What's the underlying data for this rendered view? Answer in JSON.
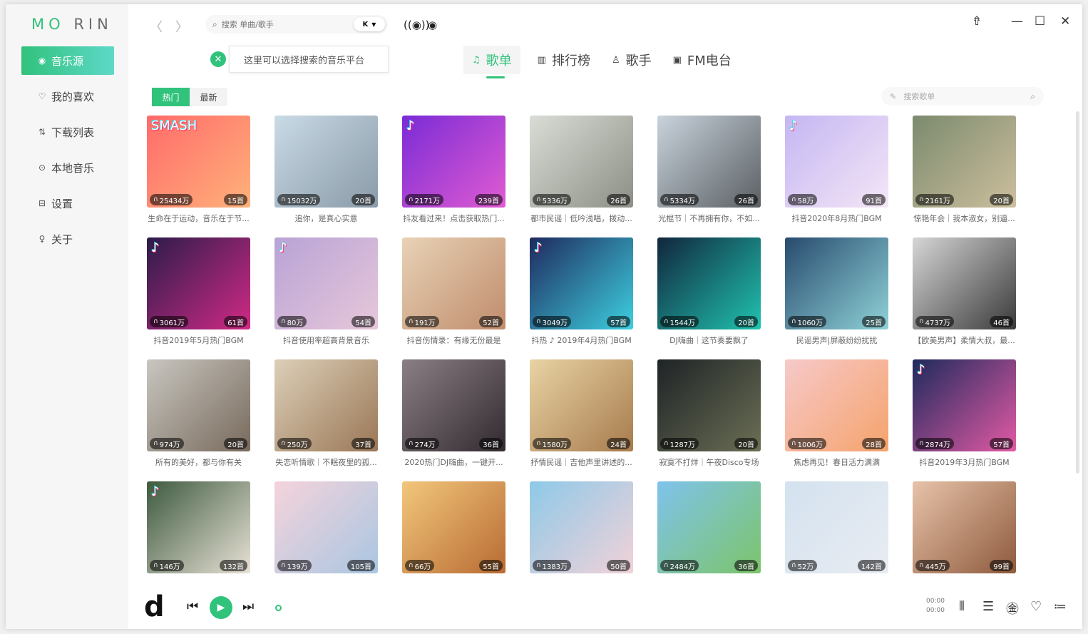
{
  "app": {
    "logo_a": "MO",
    "logo_b": "RIN"
  },
  "sidebar": {
    "items": [
      {
        "label": "音乐源",
        "icon": "music-source-icon",
        "glyph": "◉",
        "active": true
      },
      {
        "label": "我的喜欢",
        "icon": "heart-icon",
        "glyph": "♡",
        "active": false
      },
      {
        "label": "下载列表",
        "icon": "download-list-icon",
        "glyph": "⇅",
        "active": false
      },
      {
        "label": "本地音乐",
        "icon": "local-music-icon",
        "glyph": "⊙",
        "active": false
      },
      {
        "label": "设置",
        "icon": "settings-icon",
        "glyph": "⊟",
        "active": false
      },
      {
        "label": "关于",
        "icon": "bulb-icon",
        "glyph": "♀",
        "active": false
      }
    ]
  },
  "search": {
    "placeholder": "搜索 单曲/歌手",
    "platform": "K"
  },
  "tooltip": {
    "text": "这里可以选择搜索的音乐平台"
  },
  "tabs": [
    {
      "label": "歌单",
      "icon": "playlist-icon",
      "glyph": "♫",
      "active": true
    },
    {
      "label": "排行榜",
      "icon": "chart-icon",
      "glyph": "▥",
      "active": false
    },
    {
      "label": "歌手",
      "icon": "singer-icon",
      "glyph": "♙",
      "active": false
    },
    {
      "label": "FM电台",
      "icon": "radio-icon",
      "glyph": "▣",
      "active": false
    }
  ],
  "subtabs": [
    {
      "label": "热门",
      "active": true
    },
    {
      "label": "最新",
      "active": false
    }
  ],
  "playlist_search": {
    "placeholder": "搜索歌单"
  },
  "playlists": [
    {
      "title": "生命在于运动，音乐在于节...",
      "plays": "25434万",
      "count": "15首",
      "c1": "#ff6a6a",
      "c2": "#ffb27a",
      "tag": "SMASH"
    },
    {
      "title": "追你，是真心实意",
      "plays": "15032万",
      "count": "20首",
      "c1": "#c9dbe6",
      "c2": "#8a9aa8",
      "tag": ""
    },
    {
      "title": "抖友看过来！点击获取热门...",
      "plays": "2171万",
      "count": "239首",
      "c1": "#7a2bd6",
      "c2": "#e05bd2",
      "tag": "♪"
    },
    {
      "title": "都市民谣｜低吟浅唱，拨动...",
      "plays": "5336万",
      "count": "26首",
      "c1": "#d9ddd5",
      "c2": "#8c8f86",
      "tag": ""
    },
    {
      "title": "光棍节｜不再拥有你，不如...",
      "plays": "5334万",
      "count": "26首",
      "c1": "#c9d3dc",
      "c2": "#5a5f63",
      "tag": ""
    },
    {
      "title": "抖音2020年8月热门BGM",
      "plays": "58万",
      "count": "91首",
      "c1": "#c4b6f2",
      "c2": "#f4e6f6",
      "tag": "♪"
    },
    {
      "title": "惊艳年会｜我本淑女，别逼...",
      "plays": "2161万",
      "count": "20首",
      "c1": "#7b8a6e",
      "c2": "#cdbf9d",
      "tag": ""
    },
    {
      "title": "抖音2019年5月热门BGM",
      "plays": "3061万",
      "count": "61首",
      "c1": "#2c1c4a",
      "c2": "#d12a86",
      "tag": "♪"
    },
    {
      "title": "抖音使用率超高背景音乐",
      "plays": "80万",
      "count": "54首",
      "c1": "#b8a3d6",
      "c2": "#e7c7d9",
      "tag": "♪"
    },
    {
      "title": "抖音伤情录：有缘无份最是",
      "plays": "191万",
      "count": "52首",
      "c1": "#e8d2b6",
      "c2": "#c08c6c",
      "tag": ""
    },
    {
      "title": "抖热 ♪ 2019年4月热门BGM",
      "plays": "3049万",
      "count": "57首",
      "c1": "#1f2a5e",
      "c2": "#3dd0e0",
      "tag": "♪"
    },
    {
      "title": "DJ嗨曲｜这节奏要飘了",
      "plays": "1544万",
      "count": "20首",
      "c1": "#11263d",
      "c2": "#20c3b0",
      "tag": ""
    },
    {
      "title": "民谣男声|屏蔽纷纷扰扰",
      "plays": "1060万",
      "count": "25首",
      "c1": "#284b6e",
      "c2": "#8fd2d8",
      "tag": ""
    },
    {
      "title": "【欧美男声】柔情大叔，最...",
      "plays": "4737万",
      "count": "46首",
      "c1": "#d6d6d6",
      "c2": "#3a3a3a",
      "tag": ""
    },
    {
      "title": "所有的美好，都与你有关",
      "plays": "974万",
      "count": "20首",
      "c1": "#c8c6c0",
      "c2": "#786a5c",
      "tag": ""
    },
    {
      "title": "失恋听情歌｜不眠夜里的孤...",
      "plays": "250万",
      "count": "37首",
      "c1": "#dccfb8",
      "c2": "#9a7756",
      "tag": ""
    },
    {
      "title": "2020热门DJ嗨曲，一键开...",
      "plays": "274万",
      "count": "36首",
      "c1": "#8a7f85",
      "c2": "#322a30",
      "tag": ""
    },
    {
      "title": "抒情民谣｜吉他声里讲述的...",
      "plays": "1580万",
      "count": "24首",
      "c1": "#e8d3a4",
      "c2": "#a77b4d",
      "tag": ""
    },
    {
      "title": "寂寞不打烊｜午夜Disco专场",
      "plays": "1287万",
      "count": "20首",
      "c1": "#1e2326",
      "c2": "#6b6f55",
      "tag": ""
    },
    {
      "title": "焦虑再见！春日活力满满",
      "plays": "1006万",
      "count": "28首",
      "c1": "#f6c9c9",
      "c2": "#f5a36c",
      "tag": ""
    },
    {
      "title": "抖音2019年3月热门BGM",
      "plays": "2874万",
      "count": "57首",
      "c1": "#1e2a5c",
      "c2": "#e35aa5",
      "tag": "♪"
    },
    {
      "title": "",
      "plays": "146万",
      "count": "132首",
      "c1": "#3d5a3f",
      "c2": "#e9e2d6",
      "tag": "♪"
    },
    {
      "title": "",
      "plays": "139万",
      "count": "105首",
      "c1": "#f5d3db",
      "c2": "#a9c6e2",
      "tag": ""
    },
    {
      "title": "",
      "plays": "66万",
      "count": "55首",
      "c1": "#f2c77c",
      "c2": "#b86b32",
      "tag": ""
    },
    {
      "title": "",
      "plays": "1383万",
      "count": "50首",
      "c1": "#8ec9e8",
      "c2": "#f2d2d8",
      "tag": ""
    },
    {
      "title": "",
      "plays": "2484万",
      "count": "36首",
      "c1": "#7fc3ec",
      "c2": "#7cc46a",
      "tag": ""
    },
    {
      "title": "",
      "plays": "52万",
      "count": "142首",
      "c1": "#d3e2ef",
      "c2": "#e9ecf2",
      "tag": ""
    },
    {
      "title": "",
      "plays": "445万",
      "count": "99首",
      "c1": "#e7c3a9",
      "c2": "#8e5a3d",
      "tag": ""
    }
  ],
  "player": {
    "time_current": "00:00",
    "time_total": "00:00",
    "mini_glyph": "d"
  },
  "colors": {
    "accent": "#31c27c"
  }
}
